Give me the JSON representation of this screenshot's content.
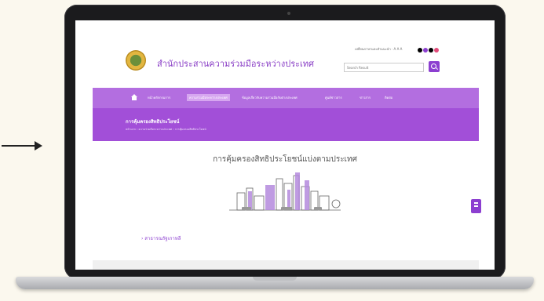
{
  "site": {
    "title": "สำนักประสานความร่วมมือระหว่างประเทศ",
    "top_links": "เปลี่ยนภาษาและคำแนะนำ · A A A",
    "search_placeholder": "Search Result",
    "theme_dots": [
      "#000000",
      "#8c3fd0",
      "#000000",
      "#e14b7a"
    ]
  },
  "nav": {
    "items": [
      "หน้าหลักกรมการ",
      "ความร่วมมือระหว่างประเทศ",
      "ข้อมูลเกี่ยวกับความร่วมมือกับต่างประเทศ",
      "ศูนย์ข่าวสาร",
      "ข่าวสาร",
      "ติดต่อ"
    ],
    "active_index": 1
  },
  "banner": {
    "title": "การคุ้มครองสิทธิประโยชน์",
    "breadcrumb": "หน้าแรก › ความร่วมมือระหว่างประเทศ › การคุ้มครองสิทธิประโยชน์"
  },
  "main": {
    "heading": "การคุ้มครองสิทธิประโยชน์แบ่งตามประเทศ",
    "link": "› สาธารณรัฐเกาหลี"
  },
  "colors": {
    "accent": "#8c3fd0",
    "nav": "#b36ee0",
    "banner": "#a24fd8"
  }
}
